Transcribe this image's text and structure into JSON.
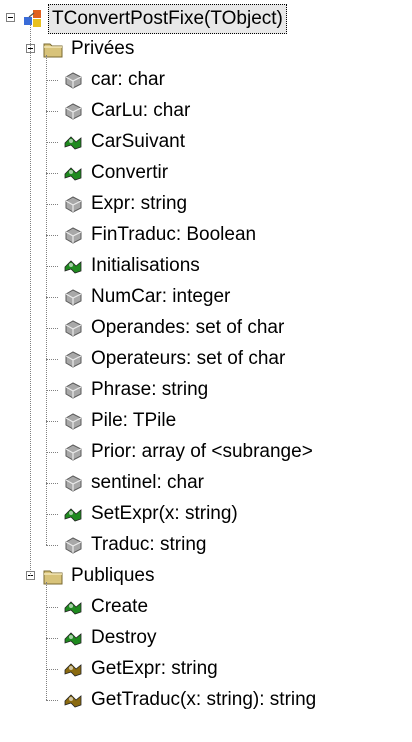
{
  "root": {
    "label": "TConvertPostFixe(TObject)",
    "icon": "class-icon"
  },
  "groups": [
    {
      "label": "Privées",
      "icon": "folder-icon",
      "items": [
        {
          "label": "car: char",
          "icon": "field-icon"
        },
        {
          "label": "CarLu: char",
          "icon": "field-icon"
        },
        {
          "label": "CarSuivant",
          "icon": "method-icon"
        },
        {
          "label": "Convertir",
          "icon": "method-icon"
        },
        {
          "label": "Expr: string",
          "icon": "field-icon"
        },
        {
          "label": "FinTraduc: Boolean",
          "icon": "field-icon"
        },
        {
          "label": "Initialisations",
          "icon": "method-icon"
        },
        {
          "label": "NumCar: integer",
          "icon": "field-icon"
        },
        {
          "label": "Operandes: set of char",
          "icon": "field-icon"
        },
        {
          "label": "Operateurs: set of char",
          "icon": "field-icon"
        },
        {
          "label": "Phrase: string",
          "icon": "field-icon"
        },
        {
          "label": "Pile: TPile",
          "icon": "field-icon"
        },
        {
          "label": "Prior: array of <subrange>",
          "icon": "field-icon"
        },
        {
          "label": "sentinel: char",
          "icon": "field-icon"
        },
        {
          "label": "SetExpr(x: string)",
          "icon": "method-icon"
        },
        {
          "label": "Traduc: string",
          "icon": "field-icon"
        }
      ]
    },
    {
      "label": "Publiques",
      "icon": "folder-icon",
      "items": [
        {
          "label": "Create",
          "icon": "method-icon"
        },
        {
          "label": "Destroy",
          "icon": "method-icon"
        },
        {
          "label": "GetExpr: string",
          "icon": "function-icon"
        },
        {
          "label": "GetTraduc(x: string): string",
          "icon": "function-icon"
        }
      ]
    }
  ],
  "colors": {
    "method": "#1f8a1f",
    "function": "#8a6a10",
    "field": "#a8a8a8",
    "folder": "#d8c37a"
  }
}
